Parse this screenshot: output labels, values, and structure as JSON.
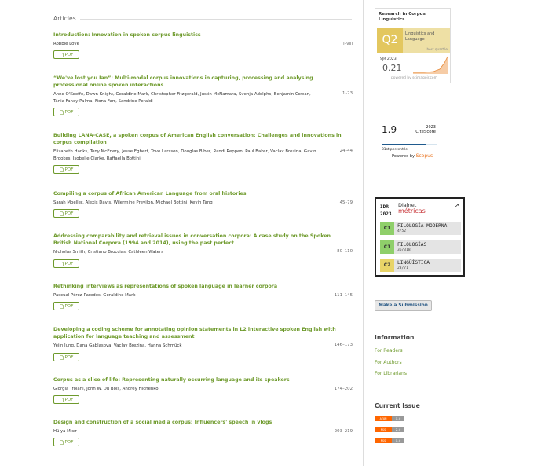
{
  "main": {
    "section_heading": "Articles",
    "pdf_label": "PDF",
    "articles": [
      {
        "title": "Introduction: Innovation in spoken corpus linguistics",
        "authors": "Robbie Love",
        "pages": "i–viii"
      },
      {
        "title": "“We've lost you Ian”: Multi-modal corpus innovations in capturing, processing and analysing professional online spoken interactions",
        "authors": "Anne O'Keeffe, Dawn Knight, Geraldine Mark, Christopher Fitzgerald, Justin McNamara, Svenja Adolphs, Benjamin Cowan, Tania Fahey Palma, Fiona Farr, Sandrine Peraldi",
        "pages": "1–23"
      },
      {
        "title": "Building LANA-CASE, a spoken corpus of American English conversation: Challenges and innovations in corpus compilation",
        "authors": "Elizabeth Hanks, Tony McEnery, Jesse Egbert, Tove Larsson, Douglas Biber, Randi Reppen, Paul Baker, Vaclav Brezina, Gavin Brookes, Isobelle Clarke, Raffaella Bottini",
        "pages": "24–44"
      },
      {
        "title": "Compiling a corpus of African American Language from oral histories",
        "authors": "Sarah Moeller, Alexis Davis, Wilermine Previlon, Michael Bottini, Kevin Tang",
        "pages": "45–79"
      },
      {
        "title": "Addressing comparability and retrieval issues in conversation corpora: A case study on the Spoken British National Corpora (1994 and 2014), using the past perfect",
        "authors": "Nicholas Smith, Cristiano Broccias, Cathleen Waters",
        "pages": "80–110"
      },
      {
        "title": "Rethinking interviews as representations of spoken language in learner corpora",
        "authors": "Pascual Pérez-Paredes, Geraldine Mark",
        "pages": "111–145"
      },
      {
        "title": "Developing a coding scheme for annotating opinion statements in L2 interactive spoken English with application for language teaching and assessment",
        "authors": "Yejin Jung, Dana Gablasova, Vaclav Brezina, Hanna Schmück",
        "pages": "146–173"
      },
      {
        "title": "Corpus as a slice of life: Representing naturally occurring language and its speakers",
        "authors": "Giorgia Troiani, John W. Du Bois, Andrey Filchenko",
        "pages": "174–202"
      },
      {
        "title": "Design and construction of a social media corpus: Influencers' speech in vlogs",
        "authors": "Hülya Mısır",
        "pages": "203–219"
      }
    ]
  },
  "sidebar": {
    "sjr": {
      "title": "Research in Corpus Linguistics",
      "quartile": "Q2",
      "category": "Linguistics and Language",
      "best": "best quartile",
      "year_label": "SJR 2023",
      "score": "0.21",
      "powered": "powered by scimagojr.com",
      "accent_color": "#e3c75f"
    },
    "citescore": {
      "score": "1.9",
      "year": "2023",
      "label": "CiteScore",
      "percentile_text": "81st percentile",
      "percentile_value": 81,
      "powered_prefix": "Powered by",
      "powered_brand": "Scopus"
    },
    "dialnet": {
      "idr": "IDR",
      "year": "2023",
      "brand_top": "Dialnet",
      "brand_bottom": "métricas",
      "rankings": [
        {
          "badge": "C1",
          "field": "FILOLOGÍA MODERNA",
          "position": "4/52",
          "color": "#8fcf6a"
        },
        {
          "badge": "C1",
          "field": "FILOLOGÍAS",
          "position": "36/318",
          "color": "#8fcf6a"
        },
        {
          "badge": "C2",
          "field": "LINGÜÍSTICA",
          "position": "23/71",
          "color": "#e8d468"
        }
      ]
    },
    "submit_label": "Make a Submission",
    "information": {
      "heading": "Information",
      "links": [
        "For Readers",
        "For Authors",
        "For Librarians"
      ]
    },
    "current_issue": {
      "heading": "Current Issue",
      "feeds": [
        {
          "left": "ATOM",
          "right": "1.0"
        },
        {
          "left": "RSS",
          "right": "2.0"
        },
        {
          "left": "RSS",
          "right": "1.0"
        }
      ]
    },
    "icons": [
      "pdf-icon",
      "external-link-icon",
      "dialnet-logo-icon"
    ]
  }
}
